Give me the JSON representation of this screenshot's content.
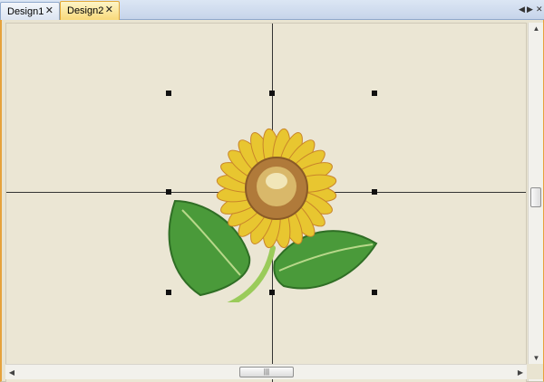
{
  "tabs": [
    {
      "label": "Design1",
      "close": "✕",
      "active": false
    },
    {
      "label": "Design2",
      "close": "✕",
      "active": true
    }
  ],
  "tab_nav": {
    "prev": "◀",
    "next": "▶",
    "close": "✕"
  },
  "scrollbars": {
    "up": "▲",
    "down": "▼",
    "left": "◀",
    "right": "▶",
    "grip": "|||"
  },
  "design": {
    "name": "sunflower-embroidery",
    "colors": {
      "petal": "#e8c630",
      "petal_stitch": "#c9852a",
      "center_outer": "#b07a3a",
      "center_inner": "#d9b86a",
      "center_highlight": "#f1e6b8",
      "leaf": "#4a9a3a",
      "leaf_dark": "#2f6e25",
      "leaf_vein": "#b8d88a",
      "stem": "#9acb5a"
    }
  },
  "canvas": {
    "background": "#ebe6d4",
    "crosshair_color": "#333333"
  }
}
